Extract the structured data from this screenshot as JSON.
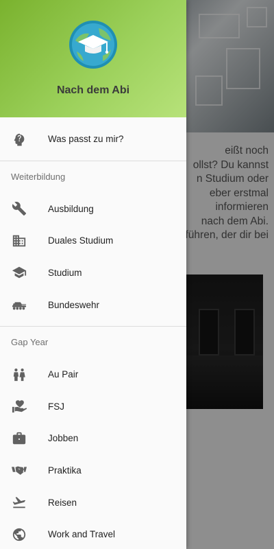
{
  "header": {
    "app_title": "Nach dem Abi",
    "logo_icon": "graduation-cap-globe-icon"
  },
  "top_item": {
    "label": "Was passt zu mir?",
    "icon": "help-head-icon"
  },
  "sections": [
    {
      "title": "Weiterbildung",
      "items": [
        {
          "label": "Ausbildung",
          "icon": "wrench-icon"
        },
        {
          "label": "Duales Studium",
          "icon": "business-icon"
        },
        {
          "label": "Studium",
          "icon": "school-icon"
        },
        {
          "label": "Bundeswehr",
          "icon": "tank-icon"
        }
      ]
    },
    {
      "title": "Gap Year",
      "items": [
        {
          "label": "Au Pair",
          "icon": "people-icon"
        },
        {
          "label": "FSJ",
          "icon": "volunteer-icon"
        },
        {
          "label": "Jobben",
          "icon": "briefcase-icon"
        },
        {
          "label": "Praktika",
          "icon": "handshake-icon"
        },
        {
          "label": "Reisen",
          "icon": "flight-takeoff-icon"
        },
        {
          "label": "Work and Travel",
          "icon": "globe-icon"
        }
      ]
    }
  ],
  "background": {
    "text_lines": [
      "eißt noch",
      "ollst? Du kannst",
      "n Studium oder",
      "eber erstmal",
      "informieren",
      "nach dem Abi.",
      "führen, der dir bei"
    ]
  },
  "colors": {
    "header_gradient_start": "#7ab22e",
    "header_gradient_end": "#b7e27a",
    "icon_color": "#616161",
    "drawer_bg": "#fafafa"
  }
}
